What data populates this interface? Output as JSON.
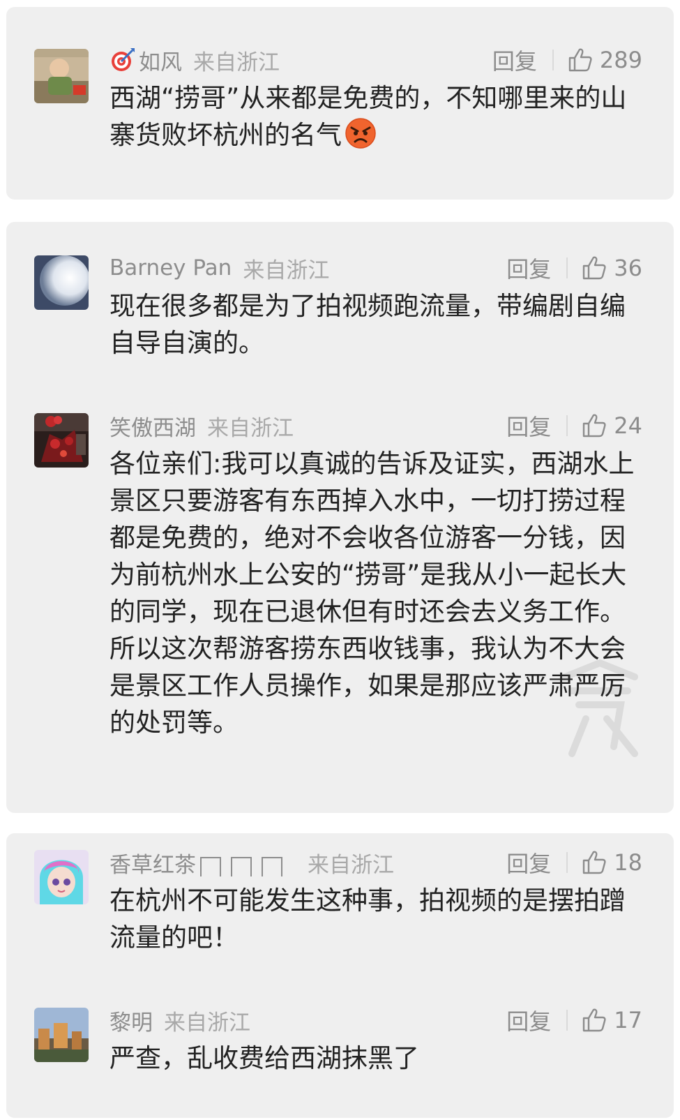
{
  "comments": [
    {
      "user": "如风",
      "location": "来自浙江",
      "reply": "回复",
      "likes": "289",
      "badge_icon": "dart-target-icon",
      "text": "西湖“捞哥”从来都是免费的，不知哪里来的山寨货败坏杭州的名气",
      "emoji": "angry-face-icon"
    },
    {
      "user": "Barney Pan",
      "location": "来自浙江",
      "reply": "回复",
      "likes": "36",
      "text": "现在很多都是为了拍视频跑流量，带编剧自编自导自演的。"
    },
    {
      "user": "笑傲西湖",
      "location": "来自浙江",
      "reply": "回复",
      "likes": "24",
      "text": "各位亲们:我可以真诚的告诉及证实，西湖水上景区只要游客有东西掉入水中，一切打捞过程都是免费的，绝对不会收各位游客一分钱，因为前杭州水上公安的“捞哥”是我从小一起长大的同学，现在已退休但有时还会去义务工作。所以这次帮游客捞东西收钱事，我认为不大会是景区工作人员操作，如果是那应该严肃严厉的处罚等。"
    },
    {
      "user": "香草红茶",
      "location": "来自浙江",
      "reply": "回复",
      "likes": "18",
      "text": "在杭州不可能发生这种事，拍视频的是摆拍蹭流量的吧！"
    },
    {
      "user": "黎明",
      "location": "来自浙江",
      "reply": "回复",
      "likes": "17",
      "text": "严查，乱收费给西湖抹黑了"
    }
  ],
  "colors": {
    "card_bg": "#efefef",
    "text": "#222222",
    "meta": "#9a9a9a"
  }
}
